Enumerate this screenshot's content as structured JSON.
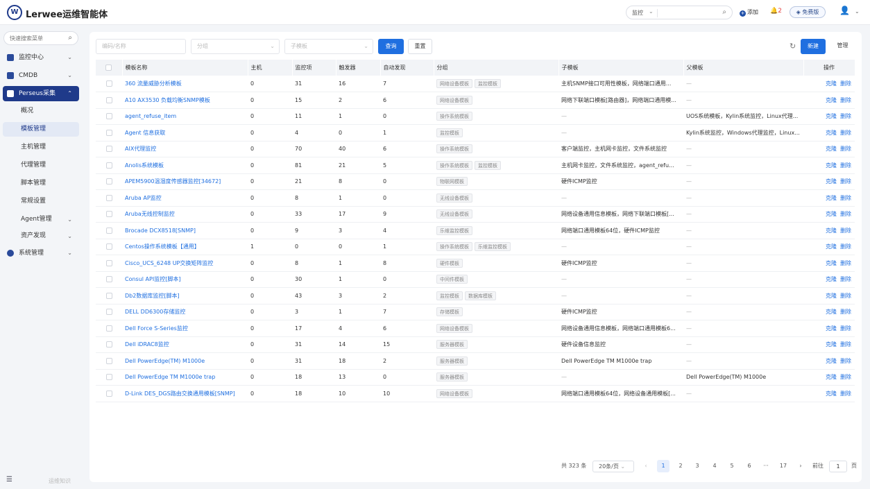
{
  "header": {
    "logo_letter": "W",
    "title": "Lerwee运维智能体",
    "search_scope": "监控",
    "add_label": "添加",
    "alert_count": "2",
    "free_label": "免费版"
  },
  "sidebar": {
    "search_placeholder": "快速搜索菜单",
    "items": [
      {
        "label": "监控中心"
      },
      {
        "label": "CMDB"
      },
      {
        "label": "Perseus采集"
      },
      {
        "label": "系统管理"
      }
    ],
    "subitems": [
      {
        "label": "概况"
      },
      {
        "label": "模板管理"
      },
      {
        "label": "主机管理"
      },
      {
        "label": "代理管理"
      },
      {
        "label": "脚本管理"
      },
      {
        "label": "常规设置"
      },
      {
        "label": "Agent管理"
      },
      {
        "label": "资产发现"
      }
    ],
    "footer_text": "运维知识"
  },
  "filters": {
    "code_name_placeholder": "编码/名称",
    "group_placeholder": "分组",
    "child_template_placeholder": "子模板",
    "query_label": "查询",
    "reset_label": "重置",
    "new_label": "新建",
    "manage_label": "管理"
  },
  "table": {
    "headers": [
      "模板名称",
      "主机",
      "监控项",
      "触发器",
      "自动发现",
      "分组",
      "子模板",
      "父模板",
      "操作"
    ],
    "op_clone": "克隆",
    "op_delete": "删除",
    "rows": [
      {
        "name": "360 流量威胁分析模板",
        "hosts": "0",
        "items": "31",
        "triggers": "16",
        "discovery": "7",
        "groups": [
          "网络设备模板",
          "监控模板"
        ],
        "child": "主机SNMP接口可用性模板，网络端口通用...",
        "parent": "—"
      },
      {
        "name": "A10 AX3530 负载均衡SNMP模板",
        "hosts": "0",
        "items": "15",
        "triggers": "2",
        "discovery": "6",
        "groups": [
          "网络设备模板"
        ],
        "child": "网络下联端口模板[路由器]，网络端口通用模...",
        "parent": "—"
      },
      {
        "name": "agent_refuse_item",
        "hosts": "0",
        "items": "11",
        "triggers": "1",
        "discovery": "0",
        "groups": [
          "操作系统模板"
        ],
        "child": "—",
        "parent": "UOS系统模板，Kylin系统监控，Linux代理..."
      },
      {
        "name": "Agent 信息获取",
        "hosts": "0",
        "items": "4",
        "triggers": "0",
        "discovery": "1",
        "groups": [
          "监控模板"
        ],
        "child": "—",
        "parent": "Kylin系统监控，Windows代理监控，Linux..."
      },
      {
        "name": "AIX代理监控",
        "hosts": "0",
        "items": "70",
        "triggers": "40",
        "discovery": "6",
        "groups": [
          "操作系统模板"
        ],
        "child": "客户端监控，主机网卡监控，文件系统监控",
        "parent": "—"
      },
      {
        "name": "Anolis系统模板",
        "hosts": "0",
        "items": "81",
        "triggers": "21",
        "discovery": "5",
        "groups": [
          "操作系统模板",
          "监控模板"
        ],
        "child": "主机网卡监控，文件系统监控，agent_refu...",
        "parent": "—"
      },
      {
        "name": "APEM5900温湿度传感器监控[34672]",
        "hosts": "0",
        "items": "21",
        "triggers": "8",
        "discovery": "0",
        "groups": [
          "物联网模板"
        ],
        "child": "硬件ICMP监控",
        "parent": "—"
      },
      {
        "name": "Aruba AP监控",
        "hosts": "0",
        "items": "8",
        "triggers": "1",
        "discovery": "0",
        "groups": [
          "无线设备模板"
        ],
        "child": "—",
        "parent": "—"
      },
      {
        "name": "Aruba无线控制监控",
        "hosts": "0",
        "items": "33",
        "triggers": "17",
        "discovery": "9",
        "groups": [
          "无线设备模板"
        ],
        "child": "网络设备通用信息模板，网络下联端口模板[...",
        "parent": "—"
      },
      {
        "name": "Brocade DCX8518[SNMP]",
        "hosts": "0",
        "items": "9",
        "triggers": "3",
        "discovery": "4",
        "groups": [
          "乐维监控模板"
        ],
        "child": "网络端口通用模板64位，硬件ICMP监控",
        "parent": "—"
      },
      {
        "name": "Centos操作系统模板【通用】",
        "hosts": "1",
        "items": "0",
        "triggers": "0",
        "discovery": "1",
        "groups": [
          "操作系统模板",
          "乐维监控模板"
        ],
        "child": "—",
        "parent": "—"
      },
      {
        "name": "Cisco_UCS_6248 UP交换矩阵监控",
        "hosts": "0",
        "items": "8",
        "triggers": "1",
        "discovery": "8",
        "groups": [
          "硬件模板"
        ],
        "child": "硬件ICMP监控",
        "parent": "—"
      },
      {
        "name": "Consul API监控[脚本]",
        "hosts": "0",
        "items": "30",
        "triggers": "1",
        "discovery": "0",
        "groups": [
          "中间件模板"
        ],
        "child": "—",
        "parent": "—"
      },
      {
        "name": "Db2数据库监控[脚本]",
        "hosts": "0",
        "items": "43",
        "triggers": "3",
        "discovery": "2",
        "groups": [
          "监控模板",
          "数据库模板"
        ],
        "child": "—",
        "parent": "—"
      },
      {
        "name": "DELL DD6300存储监控",
        "hosts": "0",
        "items": "3",
        "triggers": "1",
        "discovery": "7",
        "groups": [
          "存储模板"
        ],
        "child": "硬件ICMP监控",
        "parent": "—"
      },
      {
        "name": "Dell Force S-Series监控",
        "hosts": "0",
        "items": "17",
        "triggers": "4",
        "discovery": "6",
        "groups": [
          "网络设备模板"
        ],
        "child": "网络设备通用信息模板，网络端口通用模板6...",
        "parent": "—"
      },
      {
        "name": "Dell iDRAC8监控",
        "hosts": "0",
        "items": "31",
        "triggers": "14",
        "discovery": "15",
        "groups": [
          "服务器模板"
        ],
        "child": "硬件设备信息监控",
        "parent": "—"
      },
      {
        "name": "Dell PowerEdge(TM) M1000e",
        "hosts": "0",
        "items": "31",
        "triggers": "18",
        "discovery": "2",
        "groups": [
          "服务器模板"
        ],
        "child": "Dell PowerEdge TM M1000e trap",
        "parent": "—"
      },
      {
        "name": "Dell PowerEdge TM M1000e trap",
        "hosts": "0",
        "items": "18",
        "triggers": "13",
        "discovery": "0",
        "groups": [
          "服务器模板"
        ],
        "child": "—",
        "parent": "Dell PowerEdge(TM) M1000e"
      },
      {
        "name": "D-Link DES_DGS路由交换通用模板[SNMP]",
        "hosts": "0",
        "items": "18",
        "triggers": "10",
        "discovery": "10",
        "groups": [
          "网络设备模板"
        ],
        "child": "网络端口通用模板64位，网络设备通用模板[...",
        "parent": "—"
      }
    ]
  },
  "pagination": {
    "total": "共 323 条",
    "page_size": "20条/页",
    "prev": "‹",
    "next": "›",
    "pages": [
      "1",
      "2",
      "3",
      "4",
      "5",
      "6",
      "···",
      "17"
    ],
    "goto_label": "前往",
    "goto_value": "1",
    "page_suffix": "页"
  }
}
